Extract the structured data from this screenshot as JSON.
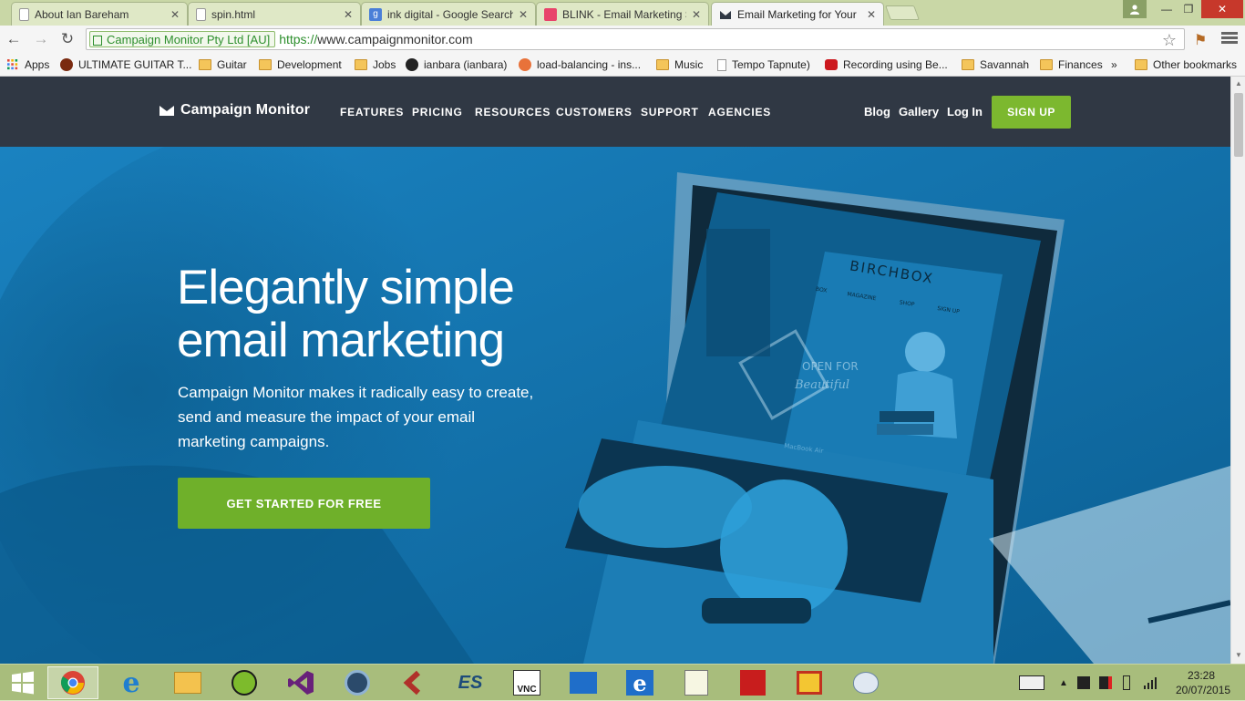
{
  "browser": {
    "tabs": [
      {
        "title": "About Ian Bareham",
        "favicon": "page-icon"
      },
      {
        "title": "spin.html",
        "favicon": "page-icon"
      },
      {
        "title": "ink digital - Google Search",
        "favicon": "google-icon"
      },
      {
        "title": "BLINK - Email Marketing S",
        "favicon": "blink-icon"
      },
      {
        "title": "Email Marketing for Your",
        "favicon": "campaign-monitor-icon",
        "active": true
      }
    ],
    "ev_label": "Campaign Monitor Pty Ltd [AU]",
    "url_scheme": "https://",
    "url_host": "www.campaignmonitor.com",
    "bookmarks": [
      {
        "label": "Apps",
        "icon": "apps-grid-icon"
      },
      {
        "label": "ULTIMATE GUITAR T...",
        "icon": "guitar-icon"
      },
      {
        "label": "Guitar",
        "icon": "folder-icon"
      },
      {
        "label": "Development",
        "icon": "folder-icon"
      },
      {
        "label": "Jobs",
        "icon": "folder-icon"
      },
      {
        "label": "ianbara (ianbara)",
        "icon": "github-icon"
      },
      {
        "label": "load-balancing - ins...",
        "icon": "stackexchange-icon"
      },
      {
        "label": "Music",
        "icon": "folder-icon"
      },
      {
        "label": "Tempo Tapnute)",
        "icon": "page-icon"
      },
      {
        "label": "Recording using Be...",
        "icon": "youtube-icon"
      },
      {
        "label": "Savannah",
        "icon": "folder-icon"
      },
      {
        "label": "Finances",
        "icon": "folder-icon"
      },
      {
        "label": "»",
        "icon": ""
      },
      {
        "label": "Other bookmarks",
        "icon": "folder-icon"
      }
    ]
  },
  "site": {
    "logo_text": "Campaign Monitor",
    "nav": [
      "FEATURES",
      "PRICING",
      "RESOURCES",
      "CUSTOMERS",
      "SUPPORT",
      "AGENCIES"
    ],
    "nav_right": [
      "Blog",
      "Gallery",
      "Log In"
    ],
    "signup": "SIGN UP",
    "hero_title_line1": "Elegantly simple",
    "hero_title_line2": "email marketing",
    "hero_sub": "Campaign Monitor makes it radically easy to create, send and measure the impact of your email marketing campaigns.",
    "cta": "GET STARTED FOR FREE",
    "laptop_screen": {
      "brand": "BIRCHBOX",
      "menu": [
        "BOX",
        "MAGAZINE",
        "SHOP",
        "SIGN UP"
      ],
      "stamp": "OPEN FOR",
      "stamp_script": "Beautiful",
      "laptop_label": "MacBook Air"
    }
  },
  "taskbar": {
    "apps": [
      "windows-start-icon",
      "chrome-icon",
      "internet-explorer-icon",
      "file-explorer-icon",
      "spotify-icon",
      "visual-studio-icon",
      "media-icon",
      "filezilla-icon",
      "es-icon",
      "vnc-icon",
      "mail-icon",
      "ie-icon",
      "notepad-icon",
      "acrobat-icon",
      "slides-icon",
      "paint-icon"
    ],
    "time": "23:28",
    "date": "20/07/2015"
  },
  "colors": {
    "nav_bg": "#303844",
    "accent_green": "#7cb82f",
    "hero_blue": "#0d7ab8"
  }
}
